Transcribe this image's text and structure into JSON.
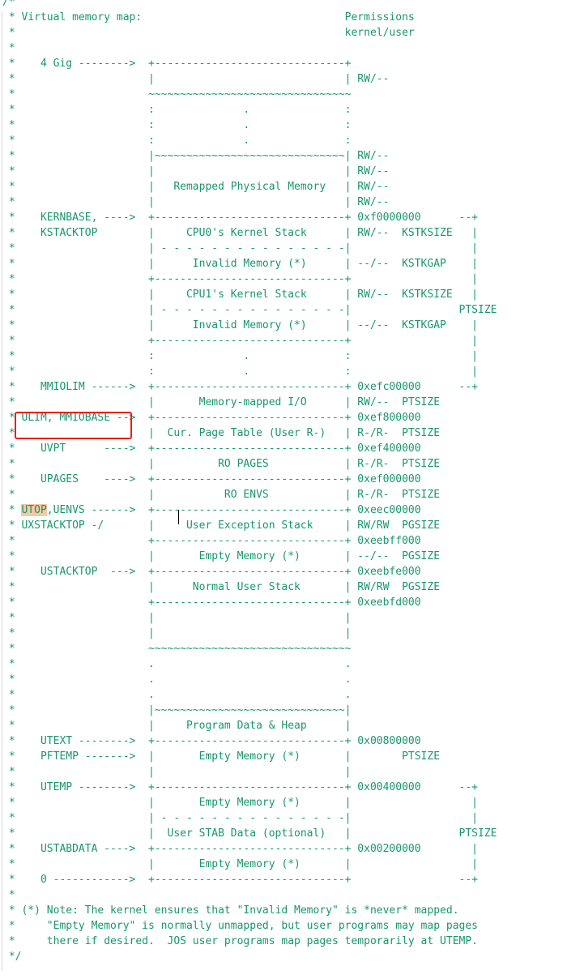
{
  "editor": {
    "lines": [
      "/*",
      " * Virtual memory map:                                Permissions",
      " *                                                    kernel/user",
      " *",
      " *    4 Gig -------->  +------------------------------+",
      " *                     |                              | RW/--",
      " *                     ~~~~~~~~~~~~~~~~~~~~~~~~~~~~~~~~",
      " *                     :              .               :",
      " *                     :              .               :",
      " *                     :              .               :",
      " *                     |~~~~~~~~~~~~~~~~~~~~~~~~~~~~~~| RW/--",
      " *                     |                              | RW/--",
      " *                     |   Remapped Physical Memory   | RW/--",
      " *                     |                              | RW/--",
      " *    KERNBASE, ---->  +------------------------------+ 0xf0000000      --+",
      " *    KSTACKTOP        |     CPU0's Kernel Stack      | RW/--  KSTKSIZE   |",
      " *                     | - - - - - - - - - - - - - - -|                   |",
      " *                     |      Invalid Memory (*)      | --/--  KSTKGAP    |",
      " *                     +------------------------------+                   |",
      " *                     |     CPU1's Kernel Stack      | RW/--  KSTKSIZE   |",
      " *                     | - - - - - - - - - - - - - - -|                 PTSIZE",
      " *                     |      Invalid Memory (*)      | --/--  KSTKGAP    |",
      " *                     +------------------------------+                   |",
      " *                     :              .               :                   |",
      " *                     :              .               :                   |",
      " *    MMIOLIM ------>  +------------------------------+ 0xefc00000      --+",
      " *                     |       Memory-mapped I/O      | RW/--  PTSIZE",
      " * ULIM, MMIOBASE -->  +------------------------------+ 0xef800000",
      " *                     |  Cur. Page Table (User R-)   | R-/R-  PTSIZE",
      " *    UVPT      ---->  +------------------------------+ 0xef400000",
      " *                     |          RO PAGES            | R-/R-  PTSIZE",
      " *    UPAGES    ---->  +------------------------------+ 0xef000000",
      " *                     |           RO ENVS            | R-/R-  PTSIZE",
      " * UTOP,UENVS ------>  +------------------------------+ 0xeec00000",
      " * UXSTACKTOP -/       |     User Exception Stack     | RW/RW  PGSIZE",
      " *                     +------------------------------+ 0xeebff000",
      " *                     |       Empty Memory (*)       | --/--  PGSIZE",
      " *    USTACKTOP  --->  +------------------------------+ 0xeebfe000",
      " *                     |      Normal User Stack       | RW/RW  PGSIZE",
      " *                     +------------------------------+ 0xeebfd000",
      " *                     |                              |",
      " *                     |                              |",
      " *                     ~~~~~~~~~~~~~~~~~~~~~~~~~~~~~~~~",
      " *                     .                              .",
      " *                     .                              .",
      " *                     .                              .",
      " *                     |~~~~~~~~~~~~~~~~~~~~~~~~~~~~~~|",
      " *                     |     Program Data & Heap      |",
      " *    UTEXT -------->  +------------------------------+ 0x00800000",
      " *    PFTEMP ------->  |       Empty Memory (*)       |        PTSIZE",
      " *                     |                              |",
      " *    UTEMP -------->  +------------------------------+ 0x00400000      --+",
      " *                     |       Empty Memory (*)       |                   |",
      " *                     | - - - - - - - - - - - - - - -|                   |",
      " *                     |  User STAB Data (optional)   |                 PTSIZE",
      " *    USTABDATA ---->  +------------------------------+ 0x00200000        |",
      " *                     |       Empty Memory (*)       |                   |",
      " *    0 ------------>  +------------------------------+                 --+",
      " *",
      " * (*) Note: The kernel ensures that \"Invalid Memory\" is *never* mapped.",
      " *     \"Empty Memory\" is normally unmapped, but user programs may map pages",
      " *     there if desired.  JOS user programs map pages temporarily at UTEMP.",
      " */"
    ],
    "highlight": {
      "word": "UTOP",
      "line_index": 33,
      "color": "#f3c9a4"
    },
    "annotation": {
      "boxed_text": "ULIM, MMIOBASE -->",
      "line_index": 27,
      "color": "#e8201c"
    },
    "colors": {
      "code_text": "#19976a",
      "background": "#ffffff",
      "cursor": "#000000"
    }
  }
}
